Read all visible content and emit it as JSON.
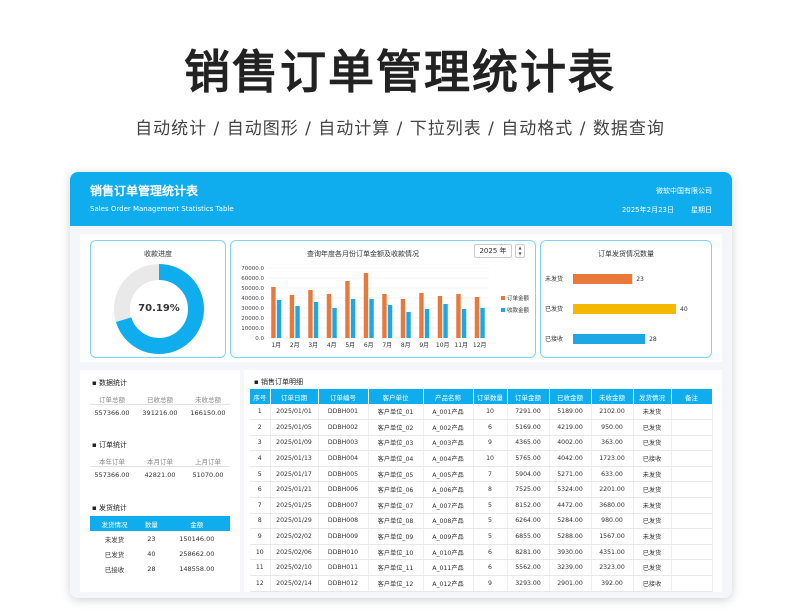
{
  "hero": {
    "title": "销售订单管理统计表",
    "subtitle": "自动统计  /  自动图形  /  自动计算    /  下拉列表  /  自动格式  /  数据查询"
  },
  "banner": {
    "title": "销售订单管理统计表",
    "subtitle": "Sales Order Management Statistics Table",
    "company": "微软中国有限公司",
    "date": "2025年2月23日",
    "weekday": "星期日"
  },
  "colors": {
    "accent": "#10adee",
    "orange": "#e8793a",
    "blue": "#1ea7e6",
    "yellow": "#f5b800"
  },
  "progress": {
    "title": "收款进度",
    "label": "70.19%",
    "fraction": 0.7019
  },
  "year_selector": {
    "value": "2025 年",
    "up": "▲",
    "down": "▼"
  },
  "chart_data": {
    "type": "bar",
    "title": "查询年度各月份订单金额及收款情况",
    "categories": [
      "1月",
      "2月",
      "3月",
      "4月",
      "5月",
      "6月",
      "7月",
      "8月",
      "9月",
      "10月",
      "11月",
      "12月"
    ],
    "ylim": [
      0,
      70000
    ],
    "yticks": [
      "0.0",
      "10000.0",
      "20000.0",
      "30000.0",
      "40000.0",
      "50000.0",
      "60000.0",
      "70000.0"
    ],
    "series": [
      {
        "name": "订单金额",
        "color": "#e8793a",
        "values": [
          51000,
          43000,
          48000,
          44000,
          57000,
          65000,
          44000,
          39000,
          45000,
          42000,
          44000,
          41000
        ]
      },
      {
        "name": "收款金额",
        "color": "#1ea7e6",
        "values": [
          38000,
          32000,
          36000,
          30000,
          39000,
          39000,
          33000,
          26000,
          29000,
          34000,
          29000,
          30000
        ]
      }
    ],
    "legend_position": "right"
  },
  "shipping_chart": {
    "title": "订单发货情况数量",
    "bars": [
      {
        "label": "未发货",
        "value": 23,
        "color": "#e8793a"
      },
      {
        "label": "已发货",
        "value": 40,
        "color": "#f5b800"
      },
      {
        "label": "已接收",
        "value": 28,
        "color": "#1ea7e6"
      }
    ],
    "max": 40
  },
  "stats": {
    "amount": {
      "title": "数据统计",
      "labels": [
        "订单总额",
        "已收总额",
        "未收总额"
      ],
      "values": [
        "557366.00",
        "391216.00",
        "166150.00"
      ]
    },
    "orders": {
      "title": "订单统计",
      "labels": [
        "本年订单",
        "本月订单",
        "上月订单"
      ],
      "values": [
        "557366.00",
        "42821.00",
        "51070.00"
      ]
    },
    "shipping": {
      "title": "发货统计",
      "headers": [
        "发货情况",
        "数量",
        "金额"
      ],
      "rows": [
        [
          "未发货",
          "23",
          "150146.00"
        ],
        [
          "已发货",
          "40",
          "258662.00"
        ],
        [
          "已接收",
          "28",
          "148558.00"
        ]
      ]
    }
  },
  "detail": {
    "title": "销售订单明细",
    "headers": [
      "序号",
      "订单日期",
      "订单编号",
      "客户单位",
      "产品名称",
      "订单数量",
      "订单金额",
      "已收金额",
      "未收金额",
      "发货情况",
      "备注"
    ],
    "rows": [
      [
        "1",
        "2025/01/01",
        "DDBH001",
        "客户单位_01",
        "A_001产品",
        "10",
        "7291.00",
        "5189.00",
        "2102.00",
        "未发货",
        ""
      ],
      [
        "2",
        "2025/01/05",
        "DDBH002",
        "客户单位_02",
        "A_002产品",
        "6",
        "5169.00",
        "4219.00",
        "950.00",
        "已发货",
        ""
      ],
      [
        "3",
        "2025/01/09",
        "DDBH003",
        "客户单位_03",
        "A_003产品",
        "9",
        "4365.00",
        "4002.00",
        "363.00",
        "已发货",
        ""
      ],
      [
        "4",
        "2025/01/13",
        "DDBH004",
        "客户单位_04",
        "A_004产品",
        "10",
        "5765.00",
        "4042.00",
        "1723.00",
        "已接收",
        ""
      ],
      [
        "5",
        "2025/01/17",
        "DDBH005",
        "客户单位_05",
        "A_005产品",
        "7",
        "5904.00",
        "5271.00",
        "633.00",
        "未发货",
        ""
      ],
      [
        "6",
        "2025/01/21",
        "DDBH006",
        "客户单位_06",
        "A_006产品",
        "8",
        "7525.00",
        "5324.00",
        "2201.00",
        "已发货",
        ""
      ],
      [
        "7",
        "2025/01/25",
        "DDBH007",
        "客户单位_07",
        "A_007产品",
        "5",
        "8152.00",
        "4472.00",
        "3680.00",
        "未发货",
        ""
      ],
      [
        "8",
        "2025/01/29",
        "DDBH008",
        "客户单位_08",
        "A_008产品",
        "5",
        "6264.00",
        "5284.00",
        "980.00",
        "已发货",
        ""
      ],
      [
        "9",
        "2025/02/02",
        "DDBH009",
        "客户单位_09",
        "A_009产品",
        "5",
        "6855.00",
        "5288.00",
        "1567.00",
        "未发货",
        ""
      ],
      [
        "10",
        "2025/02/06",
        "DDBH010",
        "客户单位_10",
        "A_010产品",
        "6",
        "8281.00",
        "3930.00",
        "4351.00",
        "已发货",
        ""
      ],
      [
        "11",
        "2025/02/10",
        "DDBH011",
        "客户单位_11",
        "A_011产品",
        "6",
        "5562.00",
        "3239.00",
        "2323.00",
        "已发货",
        ""
      ],
      [
        "12",
        "2025/02/14",
        "DDBH012",
        "客户单位_12",
        "A_012产品",
        "9",
        "3293.00",
        "2901.00",
        "392.00",
        "已接收",
        ""
      ]
    ]
  }
}
